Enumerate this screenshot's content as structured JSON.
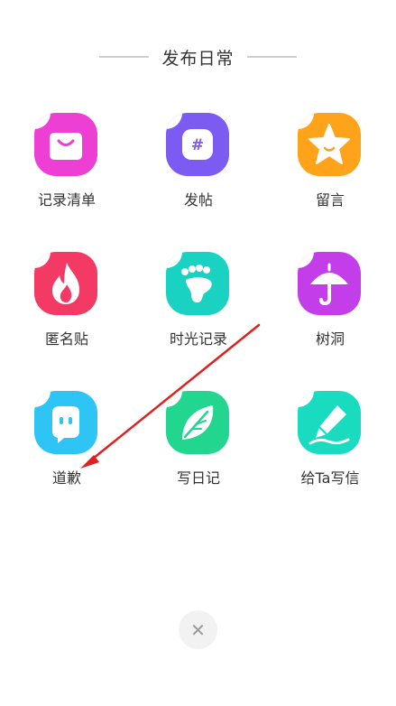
{
  "header": {
    "title": "发布日常"
  },
  "items": [
    {
      "label": "记录清单",
      "icon": "shopping-bag-icon",
      "color": "#ee3fd4"
    },
    {
      "label": "发帖",
      "icon": "hashtag-icon",
      "color": "#7b5bf2"
    },
    {
      "label": "留言",
      "icon": "star-icon",
      "color": "#ffa31a"
    },
    {
      "label": "匿名贴",
      "icon": "flame-icon",
      "color": "#f33a64"
    },
    {
      "label": "时光记录",
      "icon": "footprint-icon",
      "color": "#19d2c1"
    },
    {
      "label": "树洞",
      "icon": "umbrella-icon",
      "color": "#c33de8"
    },
    {
      "label": "道歉",
      "icon": "face-icon",
      "color": "#2ec5f4"
    },
    {
      "label": "写日记",
      "icon": "leaf-icon",
      "color": "#22d690"
    },
    {
      "label": "给Ta写信",
      "icon": "pen-icon",
      "color": "#18dbc0"
    }
  ],
  "close": {
    "icon": "close-icon",
    "glyph": "✕"
  },
  "annotation": {
    "color": "#e02020"
  }
}
